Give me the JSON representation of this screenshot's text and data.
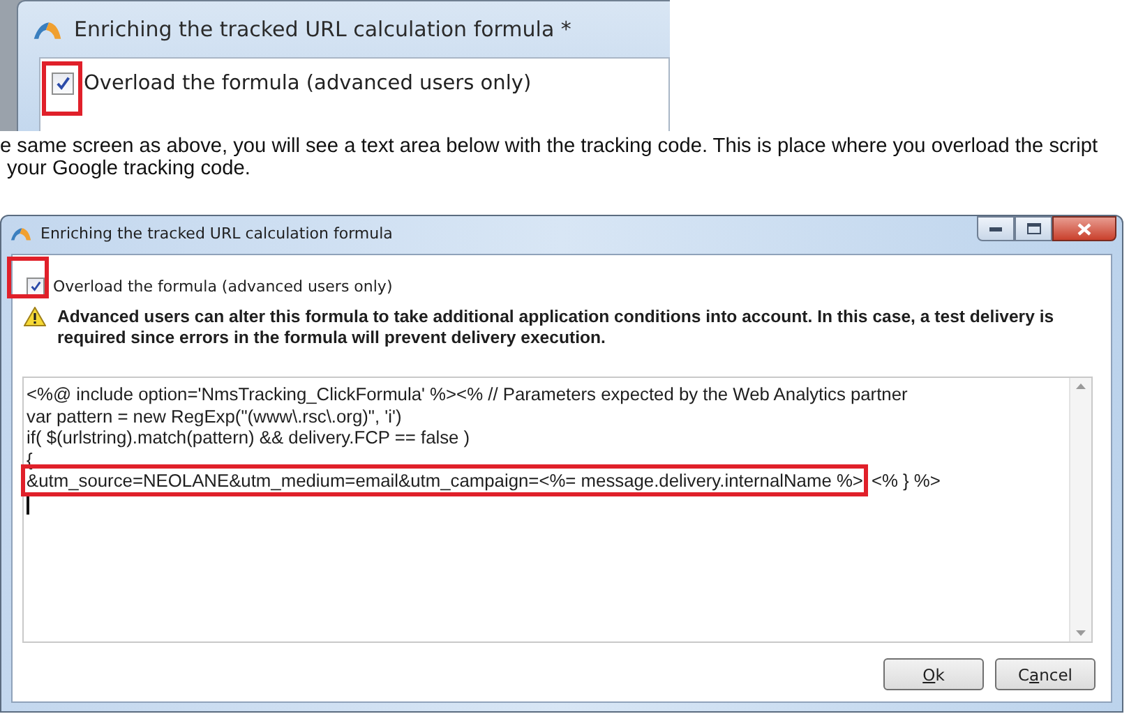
{
  "top_capture": {
    "title": "Enriching the tracked URL calculation formula *",
    "overload_checkbox": {
      "label": "Overload the formula (advanced users only)",
      "checked": true,
      "highlighted": true
    }
  },
  "paragraph": {
    "lines": [
      "e same screen as above, you will see a text area below with the tracking code. This is place where you overload the script",
      "your Google tracking code."
    ]
  },
  "dialog": {
    "title": "Enriching the tracked URL calculation formula",
    "overload_checkbox": {
      "label": "Overload the formula (advanced users only)",
      "checked": true,
      "highlighted": true
    },
    "warning": "Advanced users can alter this formula to take additional application conditions into account. In this case, a test delivery is required since errors in the formula will prevent delivery execution.",
    "code_lines": [
      {
        "segments": [
          {
            "text": "<%@ include option='NmsTracking_ClickFormula' %><% // Parameters expected by the Web Analytics partner",
            "highlighted": false
          }
        ]
      },
      {
        "segments": [
          {
            "text": "var pattern = new RegExp(\"(www\\.rsc\\.org)\", 'i')",
            "highlighted": false
          }
        ]
      },
      {
        "segments": [
          {
            "text": "if( $(urlstring).match(pattern) && delivery.FCP == false )",
            "highlighted": false
          }
        ]
      },
      {
        "segments": [
          {
            "text": "{",
            "highlighted": false
          }
        ]
      },
      {
        "segments": [
          {
            "text": "&utm_source=NEOLANE&utm_medium=email&utm_campaign=<%= message.delivery.internalName %>",
            "highlighted": true
          },
          {
            "text": "<% } %>",
            "highlighted": false
          }
        ]
      }
    ],
    "buttons": [
      {
        "label_parts": [
          {
            "text": "O",
            "underlined": true
          },
          {
            "text": "k",
            "underlined": false
          }
        ]
      },
      {
        "label_parts": [
          {
            "text": "C",
            "underlined": false
          },
          {
            "text": "a",
            "underlined": true
          },
          {
            "text": "ncel",
            "underlined": false
          }
        ]
      }
    ]
  }
}
